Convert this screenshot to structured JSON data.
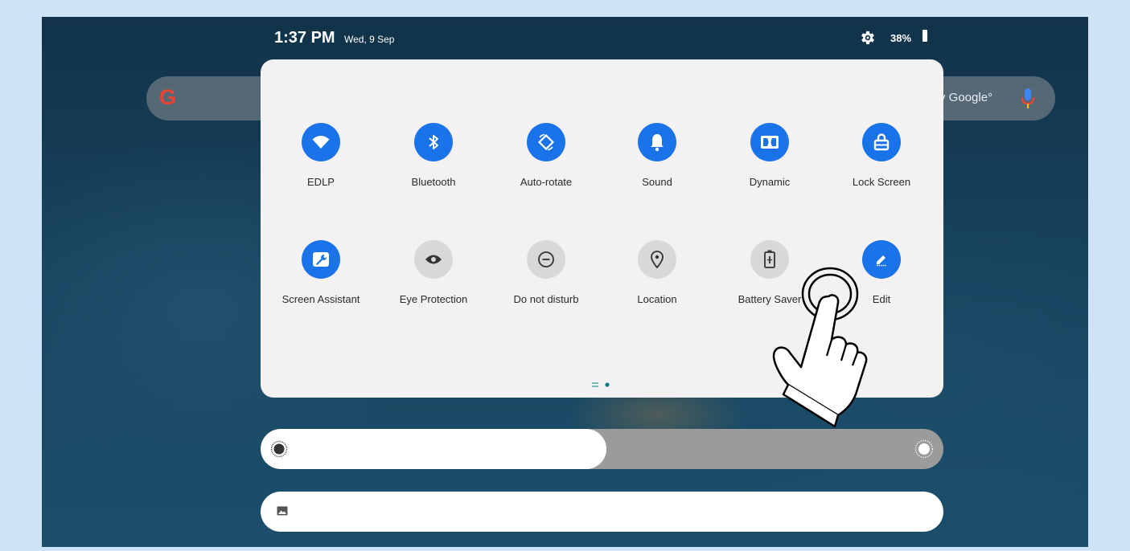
{
  "status_bar": {
    "time": "1:37 PM",
    "date": "Wed, 9 Sep",
    "battery_percent": "38%",
    "settings_icon": "gear-icon",
    "battery_icon": "battery-icon"
  },
  "search": {
    "hint_visible": "y Google°",
    "logo_letter": "G",
    "mic_icon": "mic-icon"
  },
  "quick_settings": {
    "tiles": [
      {
        "label": "EDLP",
        "icon": "wifi-icon",
        "state": "on"
      },
      {
        "label": "Bluetooth",
        "icon": "bluetooth-icon",
        "state": "on"
      },
      {
        "label": "Auto-rotate",
        "icon": "auto-rotate-icon",
        "state": "on"
      },
      {
        "label": "Sound",
        "icon": "bell-icon",
        "state": "on"
      },
      {
        "label": "Dynamic",
        "icon": "dolby-icon",
        "state": "on"
      },
      {
        "label": "Lock Screen",
        "icon": "lock-icon",
        "state": "on"
      },
      {
        "label": "Screen Assistant",
        "icon": "wrench-icon",
        "state": "on"
      },
      {
        "label": "Eye Protection",
        "icon": "eye-icon",
        "state": "off"
      },
      {
        "label": "Do not disturb",
        "icon": "do-not-disturb-icon",
        "state": "off"
      },
      {
        "label": "Location",
        "icon": "location-pin-icon",
        "state": "off"
      },
      {
        "label": "Battery Saver",
        "icon": "battery-saver-icon",
        "state": "off"
      },
      {
        "label": "Edit",
        "icon": "edit-icon",
        "state": "on"
      }
    ],
    "page_indicator": {
      "pages": 2,
      "current": 2
    }
  },
  "brightness": {
    "level": 0.5,
    "low_icon": "brightness-low-icon",
    "high_icon": "brightness-high-icon"
  },
  "media": {
    "icon": "image-icon"
  },
  "colors": {
    "accent": "#1a73e8",
    "panel": "#f3f1f2",
    "tile_off": "#d9d7d8"
  }
}
